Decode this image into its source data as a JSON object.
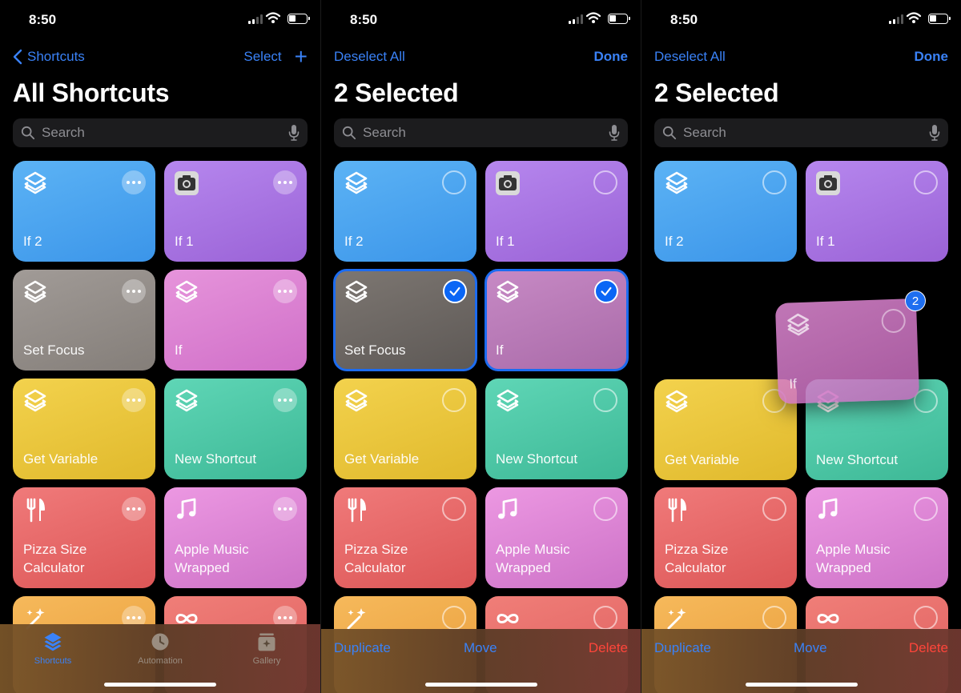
{
  "status": {
    "time": "8:50"
  },
  "screen1": {
    "nav": {
      "back": "Shortcuts",
      "select": "Select"
    },
    "title": "All Shortcuts",
    "search_placeholder": "Search",
    "tabs": [
      {
        "label": "Shortcuts",
        "icon": "layers-icon"
      },
      {
        "label": "Automation",
        "icon": "clock-icon"
      },
      {
        "label": "Gallery",
        "icon": "gallery-icon"
      }
    ]
  },
  "screen2": {
    "nav": {
      "left": "Deselect All",
      "right": "Done"
    },
    "title": "2 Selected",
    "search_placeholder": "Search",
    "actions": {
      "duplicate": "Duplicate",
      "move": "Move",
      "delete": "Delete"
    }
  },
  "screen3": {
    "nav": {
      "left": "Deselect All",
      "right": "Done"
    },
    "title": "2 Selected",
    "search_placeholder": "Search",
    "drag_badge": "2",
    "actions": {
      "duplicate": "Duplicate",
      "move": "Move",
      "delete": "Delete"
    }
  },
  "shortcuts": [
    {
      "name": "If 2",
      "color": "#4aa6f0",
      "icon": "layers-icon"
    },
    {
      "name": "If 1",
      "color": "#a876e2",
      "icon": "camera-icon"
    },
    {
      "name": "Set Focus",
      "color": "#938d89",
      "icon": "layers-icon"
    },
    {
      "name": "If",
      "color": "#dc83d3",
      "icon": "layers-icon"
    },
    {
      "name": "Get Variable",
      "color": "#ebc63a",
      "icon": "layers-icon"
    },
    {
      "name": "New Shortcut",
      "color": "#4dc8a6",
      "icon": "layers-icon"
    },
    {
      "name": "Pizza Size Calculator",
      "color": "#e86868",
      "icon": "fork-knife-icon"
    },
    {
      "name": "Apple Music Wrapped",
      "color": "#dc85d5",
      "icon": "music-note-icon"
    },
    {
      "name": "",
      "color": "#f0ac4a",
      "icon": "magic-wand-icon"
    },
    {
      "name": "",
      "color": "#e76c6b",
      "icon": "infinity-icon"
    }
  ],
  "drag_item": {
    "name": "If"
  },
  "colors": {
    "accent": "#3a82f7",
    "destructive": "#ff453a",
    "background": "#000000"
  }
}
